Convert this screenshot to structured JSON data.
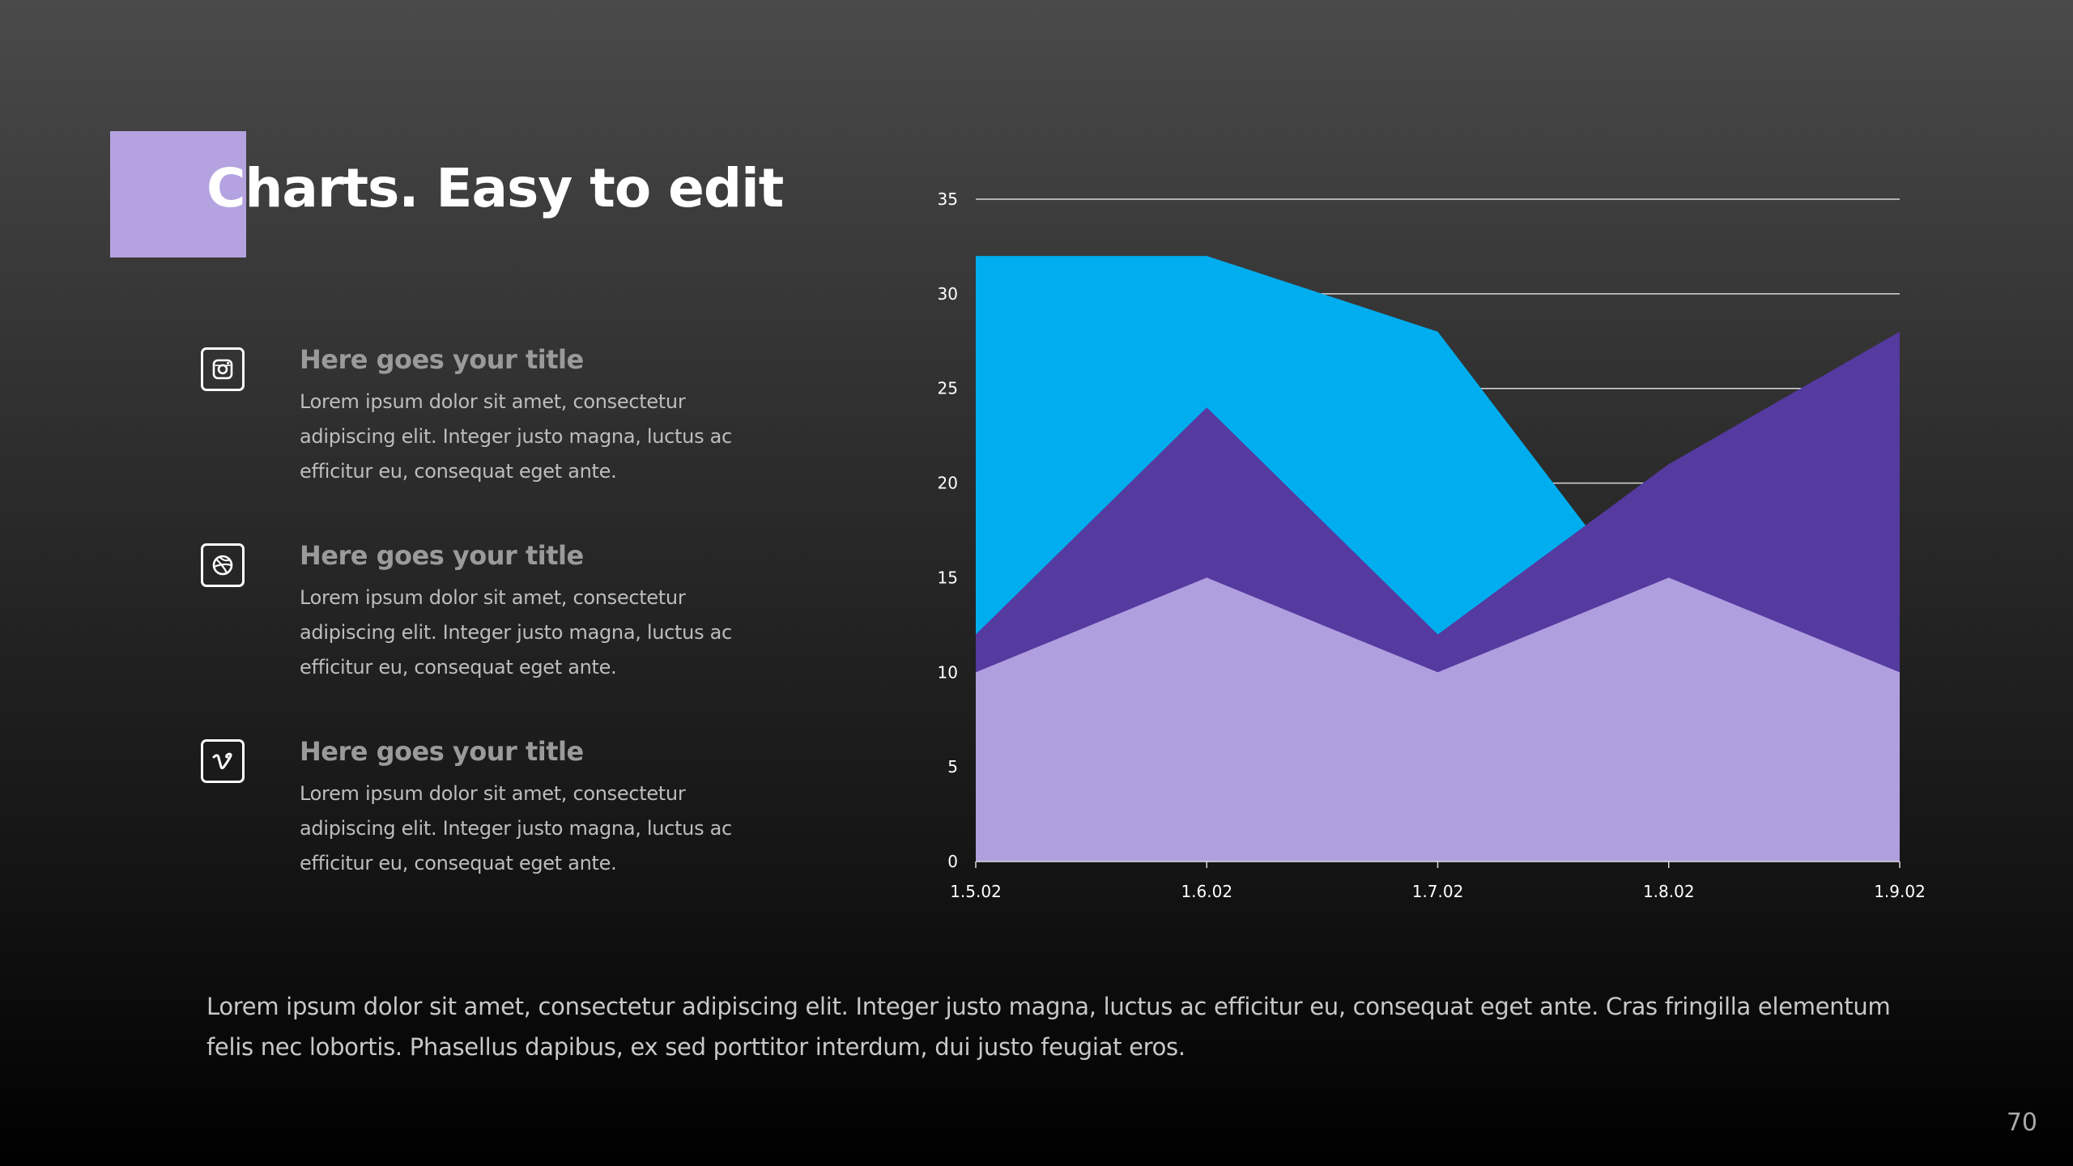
{
  "slide": {
    "title": "Charts. Easy to edit",
    "accent_color": "#b4a3e0",
    "features": [
      {
        "icon": "instagram-icon",
        "title": "Here goes your title",
        "body": "Lorem ipsum dolor sit amet, consectetur adipiscing elit. Integer justo magna, luctus ac efficitur eu, consequat eget ante."
      },
      {
        "icon": "dribbble-icon",
        "title": "Here goes your title",
        "body": "Lorem ipsum dolor sit amet, consectetur adipiscing elit. Integer justo magna, luctus ac efficitur eu, consequat eget ante."
      },
      {
        "icon": "vimeo-icon",
        "title": "Here goes your title",
        "body": "Lorem ipsum dolor sit amet, consectetur adipiscing elit. Integer justo magna, luctus ac efficitur eu, consequat eget ante."
      }
    ],
    "footer_text": "Lorem ipsum dolor sit amet, consectetur adipiscing elit. Integer justo magna, luctus ac efficitur eu, consequat eget ante. Cras fringilla elementum felis nec lobortis. Phasellus dapibus, ex sed porttitor interdum, dui justo feugiat eros.",
    "page_number": "70"
  },
  "chart_data": {
    "type": "area",
    "stacking": "overlapping",
    "x": [
      "1.5.02",
      "1.6.02",
      "1.7.02",
      "1.8.02",
      "1.9.02"
    ],
    "ylim": [
      0,
      35
    ],
    "yticks": [
      "0",
      "5",
      "10",
      "15",
      "20",
      "25",
      "30",
      "35"
    ],
    "grid": true,
    "legend": "none",
    "series": [
      {
        "color": "#00aeef",
        "values": [
          32,
          32,
          28,
          12,
          12
        ]
      },
      {
        "color": "#553aa0",
        "values": [
          12,
          24,
          12,
          21,
          28
        ]
      },
      {
        "color": "#b09fdf",
        "values": [
          10,
          15,
          10,
          15,
          10
        ]
      }
    ]
  }
}
